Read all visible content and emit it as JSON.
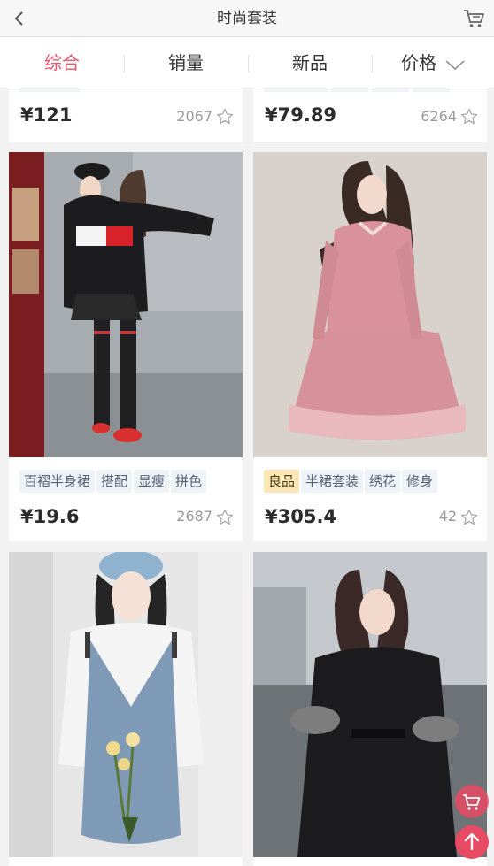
{
  "header": {
    "title": "时尚套装"
  },
  "tabs": [
    {
      "label": "综合",
      "active": true
    },
    {
      "label": "销量",
      "active": false
    },
    {
      "label": "新品",
      "active": false
    },
    {
      "label": "价格",
      "active": false
    }
  ],
  "products": [
    {
      "price": "¥121",
      "count": "2067",
      "tags": []
    },
    {
      "price": "¥79.89",
      "count": "6264",
      "tags": []
    },
    {
      "price": "¥19.6",
      "count": "2687",
      "tags": [
        "百褶半身裙",
        "搭配",
        "显瘦",
        "拼色"
      ]
    },
    {
      "price": "¥305.4",
      "count": "42",
      "tags": [
        "良品",
        "半裙套装",
        "绣花",
        "修身"
      ]
    },
    {
      "price": "",
      "count": "",
      "tags": []
    },
    {
      "price": "",
      "count": "",
      "tags": []
    }
  ],
  "colors": {
    "accent": "#e8566d",
    "fab": "#e84a64"
  },
  "icons": {
    "back": "chevron-left-icon",
    "cart": "shopping-cart-icon",
    "sort": "chevron-down-icon",
    "favorite": "star-outline-icon",
    "scroll_top": "arrow-up-icon"
  }
}
